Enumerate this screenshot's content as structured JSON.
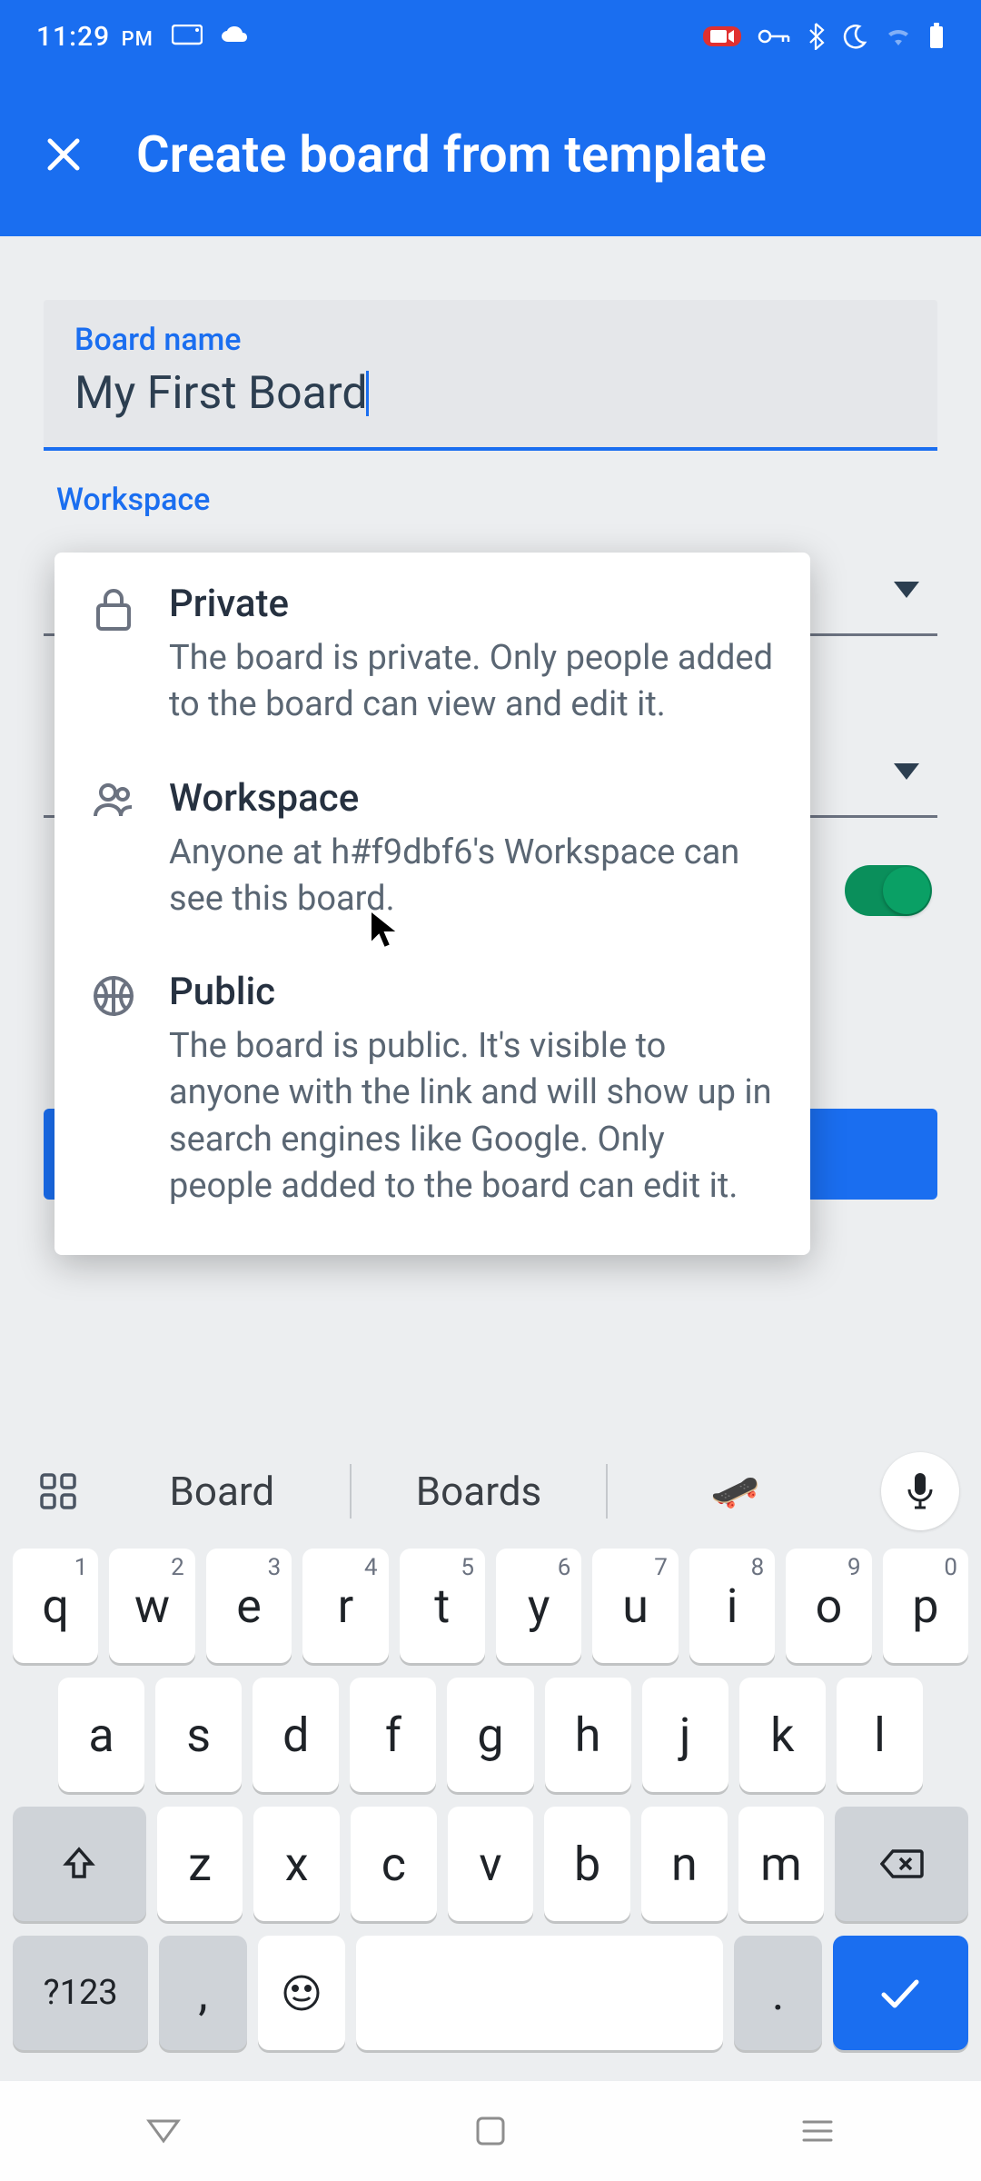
{
  "status": {
    "time": "11:29",
    "ampm": "PM"
  },
  "appbar": {
    "title": "Create board from template"
  },
  "form": {
    "board_name_label": "Board name",
    "board_name_value": "My First Board",
    "workspace_label": "Workspace"
  },
  "visibility_options": [
    {
      "title": "Private",
      "desc": "The board is private. Only people added to the board can view and edit it."
    },
    {
      "title": "Workspace",
      "desc": "Anyone at h#f9dbf6's Workspace can see this board."
    },
    {
      "title": "Public",
      "desc": "The board is public. It's visible to anyone with the link and will show up in search engines like Google. Only people added to the board can edit it."
    }
  ],
  "keyboard": {
    "suggestions": [
      "Board",
      "Boards"
    ],
    "suggestion_emoji": "🛹",
    "rows": [
      [
        "q",
        "w",
        "e",
        "r",
        "t",
        "y",
        "u",
        "i",
        "o",
        "p"
      ],
      [
        "a",
        "s",
        "d",
        "f",
        "g",
        "h",
        "j",
        "k",
        "l"
      ],
      [
        "z",
        "x",
        "c",
        "v",
        "b",
        "n",
        "m"
      ]
    ],
    "nums": [
      "1",
      "2",
      "3",
      "4",
      "5",
      "6",
      "7",
      "8",
      "9",
      "0"
    ],
    "symbol_key": "?123",
    "comma": ",",
    "period": "."
  }
}
